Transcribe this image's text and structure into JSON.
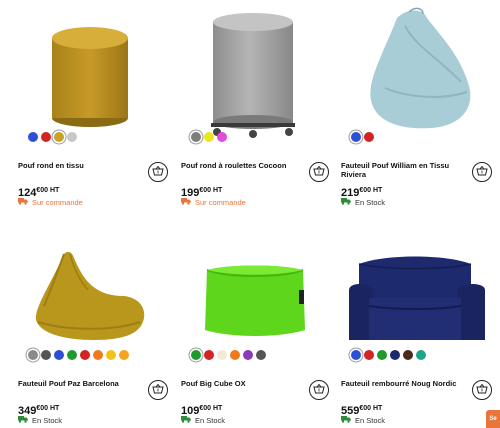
{
  "products": [
    {
      "name": "Pouf rond en tissu",
      "price_int": "124",
      "price_dec": "€00 HT",
      "availability": "Sur commande",
      "availability_type": "order",
      "swatches": [
        "#2d4fd6",
        "#d42323",
        "#c9a227",
        "#c8c8c8"
      ],
      "selected_swatch": 2
    },
    {
      "name": "Pouf rond à roulettes Cocoon",
      "price_int": "199",
      "price_dec": "€00 HT",
      "availability": "Sur commande",
      "availability_type": "order",
      "swatches": [
        "#7d7d7d",
        "#e8e81c",
        "#e24ad8"
      ],
      "selected_swatch": 0
    },
    {
      "name": "Fauteuil Pouf William en Tissu Riviera",
      "price_int": "219",
      "price_dec": "€00 HT",
      "availability": "En Stock",
      "availability_type": "stock",
      "swatches": [
        "#2d4fd6",
        "#d42323"
      ],
      "selected_swatch": 0
    },
    {
      "name": "Fauteuil Pouf Paz Barcelona",
      "price_int": "349",
      "price_dec": "€00 HT",
      "availability": "En Stock",
      "availability_type": "stock",
      "swatches": [
        "#8a8a8a",
        "#555555",
        "#2d4fd6",
        "#1e9a2e",
        "#d42323",
        "#f07a1c",
        "#f2c21a",
        "#f5a41c"
      ],
      "selected_swatch": 0
    },
    {
      "name": "Pouf Big Cube OX",
      "price_int": "109",
      "price_dec": "€00 HT",
      "availability": "En Stock",
      "availability_type": "stock",
      "swatches": [
        "#1e9a2e",
        "#d42323",
        "#f1ead6",
        "#f07a1c",
        "#8a3bb5",
        "#555555"
      ],
      "selected_swatch": 0
    },
    {
      "name": "Fauteuil rembourré Noug Nordic",
      "price_int": "559",
      "price_dec": "€00 HT",
      "availability": "En Stock",
      "availability_type": "stock",
      "swatches": [
        "#2d4fd6",
        "#d42323",
        "#1e9a2e",
        "#1c2a6b",
        "#4a2c1a",
        "#1aa78a"
      ],
      "selected_swatch": 0
    }
  ],
  "colors": {
    "order_accent": "#e8763a",
    "stock_icon": "#2e8b3a"
  },
  "corner_button_label": "Se"
}
